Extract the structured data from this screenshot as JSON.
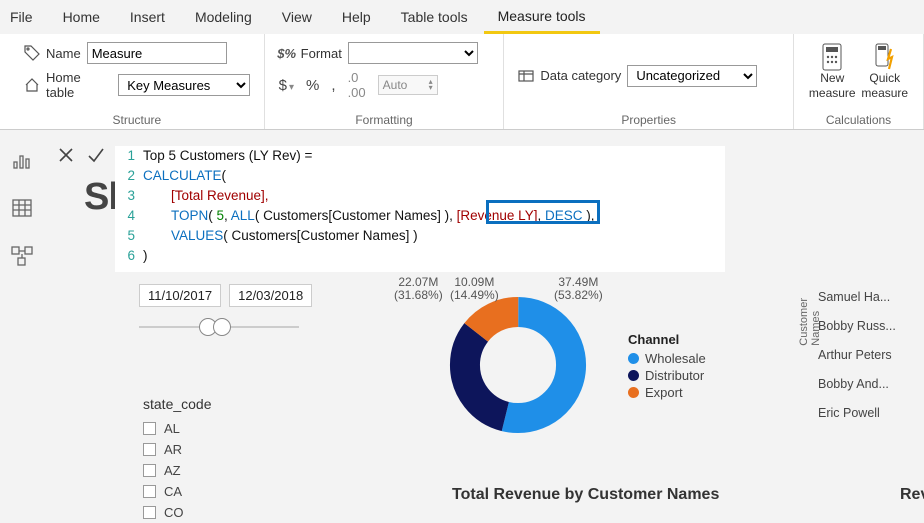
{
  "tabs": {
    "file": "File",
    "home": "Home",
    "insert": "Insert",
    "modeling": "Modeling",
    "view": "View",
    "help": "Help",
    "tabletools": "Table tools",
    "measuretools": "Measure tools"
  },
  "ribbon": {
    "structure": {
      "name_label": "Name",
      "name_value": "Measure",
      "home_label": "Home table",
      "home_value": "Key Measures",
      "group": "Structure"
    },
    "formatting": {
      "format_label": "Format",
      "format_value": "",
      "auto_label": "Auto",
      "dollar": "$",
      "percent": "%",
      "comma": ",",
      "group": "Formatting"
    },
    "properties": {
      "datacat_label": "Data category",
      "datacat_value": "Uncategorized",
      "group": "Properties"
    },
    "calculations": {
      "new_l1": "New",
      "new_l2": "measure",
      "quick_l1": "Quick",
      "quick_l2": "measure",
      "group": "Calculations"
    }
  },
  "formula": {
    "l1": "Top 5 Customers (LY Rev) =",
    "l2_a": "CALCULATE",
    "l2_b": "(",
    "l3": "[Total Revenue],",
    "l4_a": "TOPN",
    "l4_b": "( ",
    "l4_num": "5",
    "l4_c": ", ",
    "l4_d": "ALL",
    "l4_e": "( Customers[Customer Names] )",
    "l4_f": ", ",
    "l4_meas": "[Revenue LY]",
    "l4_g": ", ",
    "l4_h": "DESC",
    "l4_i": " ),",
    "l5_a": "VALUES",
    "l5_b": "( Customers[Customer Names] )",
    "l6": ")"
  },
  "ghost": "Sh",
  "slicer": {
    "start": "11/10/2017",
    "end": "12/03/2018"
  },
  "state": {
    "title": "state_code",
    "items": [
      "AL",
      "AR",
      "AZ",
      "CA",
      "CO"
    ]
  },
  "donut": {
    "top": {
      "v": "10.09M",
      "p": "(14.49%)"
    },
    "left": {
      "v": "22.07M",
      "p": "(31.68%)"
    },
    "right": {
      "v": "37.49M",
      "p": "(53.82%)"
    }
  },
  "legend": {
    "title": "Channel",
    "items": [
      {
        "label": "Wholesale",
        "color": "#1f8fe8"
      },
      {
        "label": "Distributor",
        "color": "#0d155b"
      },
      {
        "label": "Export",
        "color": "#e86f1f"
      }
    ]
  },
  "axis_label": "Customer Names",
  "customers": [
    "Samuel Ha...",
    "Bobby Russ...",
    "Arthur Peters",
    "Bobby And...",
    "Eric Powell"
  ],
  "chart_title": "Total Revenue by Customer Names",
  "rev_cut": "Rev",
  "chart_data": [
    {
      "type": "pie",
      "title": "Channel",
      "series": [
        {
          "name": "Wholesale",
          "value": 37.49,
          "percent": 53.82,
          "color": "#1f8fe8"
        },
        {
          "name": "Distributor",
          "value": 22.07,
          "percent": 31.68,
          "color": "#0d155b"
        },
        {
          "name": "Export",
          "value": 10.09,
          "percent": 14.49,
          "color": "#e86f1f"
        }
      ],
      "unit": "M"
    },
    {
      "type": "bar",
      "title": "Total Revenue by Customer Names",
      "categories": [
        "Samuel Ha...",
        "Bobby Russ...",
        "Arthur Peters",
        "Bobby And...",
        "Eric Powell"
      ],
      "values": null,
      "ylabel": "Customer Names"
    }
  ]
}
